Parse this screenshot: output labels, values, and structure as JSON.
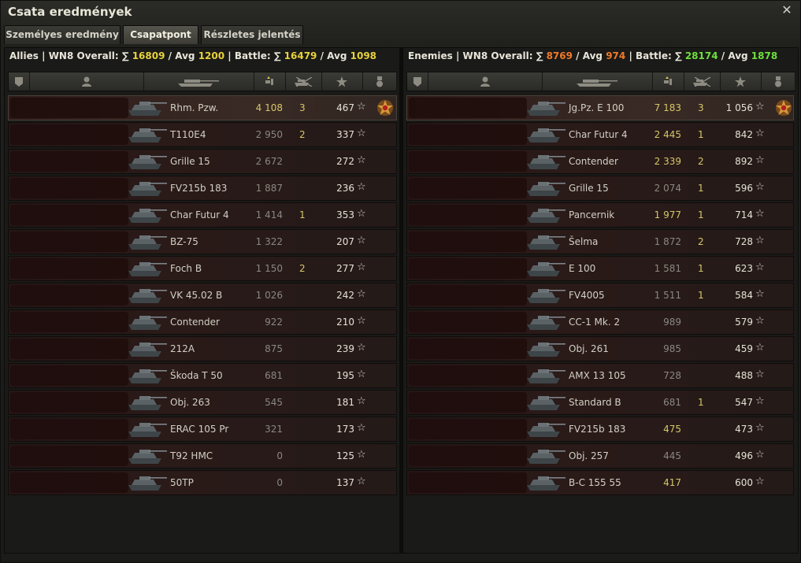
{
  "window": {
    "title": "Csata eredmények"
  },
  "tabs": [
    {
      "label": "Személyes eredmény",
      "active": false
    },
    {
      "label": "Csapatpont",
      "active": true
    },
    {
      "label": "Részletes jelentés",
      "active": false
    }
  ],
  "colors": {
    "yellow": "#e8d23c",
    "orange": "#f07a28",
    "green": "#6ee03c",
    "dmg_gray": "#8a8880",
    "dmg_dim": "#a8a694",
    "dmg_yellow": "#d6c66a"
  },
  "allies": {
    "header": {
      "team": "Allies",
      "sep1": "|",
      "wn8_label": "WN8 Overall:",
      "sum_sym": "∑",
      "overall_sum": "16809",
      "avg_sep": "/",
      "avg_label": "Avg",
      "overall_avg": "1200",
      "sep2": "|",
      "battle_label": "Battle:",
      "battle_sum": "16479",
      "battle_avg": "1098",
      "overall_sum_color": "yellow",
      "overall_avg_color": "yellow",
      "battle_sum_color": "yellow",
      "battle_avg_color": "yellow"
    },
    "rows": [
      {
        "vehicle": "Rhm. Pzw.",
        "damage": "4 108",
        "dmg_tone": "dmg_yellow",
        "kills": "3",
        "xp": "467",
        "top": true
      },
      {
        "vehicle": "T110E4",
        "damage": "2 950",
        "dmg_tone": "dmg_gray",
        "kills": "2",
        "xp": "337"
      },
      {
        "vehicle": "Grille 15",
        "damage": "2 672",
        "dmg_tone": "dmg_gray",
        "kills": "",
        "xp": "272"
      },
      {
        "vehicle": "FV215b 183",
        "damage": "1 887",
        "dmg_tone": "dmg_gray",
        "kills": "",
        "xp": "236"
      },
      {
        "vehicle": "Char Futur 4",
        "damage": "1 414",
        "dmg_tone": "dmg_gray",
        "kills": "1",
        "xp": "353"
      },
      {
        "vehicle": "BZ-75",
        "damage": "1 322",
        "dmg_tone": "dmg_gray",
        "kills": "",
        "xp": "207"
      },
      {
        "vehicle": "Foch B",
        "damage": "1 150",
        "dmg_tone": "dmg_gray",
        "kills": "2",
        "xp": "277"
      },
      {
        "vehicle": "VK 45.02 B",
        "damage": "1 026",
        "dmg_tone": "dmg_gray",
        "kills": "",
        "xp": "242"
      },
      {
        "vehicle": "Contender",
        "damage": "922",
        "dmg_tone": "dmg_gray",
        "kills": "",
        "xp": "210"
      },
      {
        "vehicle": "212A",
        "damage": "875",
        "dmg_tone": "dmg_gray",
        "kills": "",
        "xp": "239"
      },
      {
        "vehicle": "Škoda T 50",
        "damage": "681",
        "dmg_tone": "dmg_gray",
        "kills": "",
        "xp": "195"
      },
      {
        "vehicle": "Obj. 263",
        "damage": "545",
        "dmg_tone": "dmg_gray",
        "kills": "",
        "xp": "181"
      },
      {
        "vehicle": "ERAC 105 Pr",
        "damage": "321",
        "dmg_tone": "dmg_gray",
        "kills": "",
        "xp": "173"
      },
      {
        "vehicle": "T92 HMC",
        "damage": "0",
        "dmg_tone": "dmg_gray",
        "kills": "",
        "xp": "125"
      },
      {
        "vehicle": "50TP",
        "damage": "0",
        "dmg_tone": "dmg_gray",
        "kills": "",
        "xp": "137"
      }
    ]
  },
  "enemies": {
    "header": {
      "team": "Enemies",
      "sep1": "|",
      "wn8_label": "WN8 Overall:",
      "sum_sym": "∑",
      "overall_sum": "8769",
      "avg_sep": "/",
      "avg_label": "Avg",
      "overall_avg": "974",
      "sep2": "|",
      "battle_label": "Battle:",
      "battle_sum": "28174",
      "battle_avg": "1878",
      "overall_sum_color": "orange",
      "overall_avg_color": "orange",
      "battle_sum_color": "green",
      "battle_avg_color": "green"
    },
    "rows": [
      {
        "vehicle": "Jg.Pz. E 100",
        "damage": "7 183",
        "dmg_tone": "dmg_yellow",
        "kills": "3",
        "xp": "1 056",
        "top": true
      },
      {
        "vehicle": "Char Futur 4",
        "damage": "2 445",
        "dmg_tone": "dmg_yellow",
        "kills": "1",
        "xp": "842"
      },
      {
        "vehicle": "Contender",
        "damage": "2 339",
        "dmg_tone": "dmg_yellow",
        "kills": "2",
        "xp": "892"
      },
      {
        "vehicle": "Grille 15",
        "damage": "2 074",
        "dmg_tone": "dmg_gray",
        "kills": "1",
        "xp": "596"
      },
      {
        "vehicle": "Pancernik",
        "damage": "1 977",
        "dmg_tone": "dmg_yellow",
        "kills": "1",
        "xp": "714"
      },
      {
        "vehicle": "Šelma",
        "damage": "1 872",
        "dmg_tone": "dmg_gray",
        "kills": "2",
        "xp": "728"
      },
      {
        "vehicle": "E 100",
        "damage": "1 581",
        "dmg_tone": "dmg_gray",
        "kills": "1",
        "xp": "623"
      },
      {
        "vehicle": "FV4005",
        "damage": "1 511",
        "dmg_tone": "dmg_gray",
        "kills": "1",
        "xp": "584"
      },
      {
        "vehicle": "CC-1 Mk. 2",
        "damage": "989",
        "dmg_tone": "dmg_gray",
        "kills": "",
        "xp": "579"
      },
      {
        "vehicle": "Obj. 261",
        "damage": "985",
        "dmg_tone": "dmg_gray",
        "kills": "",
        "xp": "459"
      },
      {
        "vehicle": "AMX 13 105",
        "damage": "728",
        "dmg_tone": "dmg_gray",
        "kills": "",
        "xp": "488"
      },
      {
        "vehicle": "Standard B",
        "damage": "681",
        "dmg_tone": "dmg_gray",
        "kills": "1",
        "xp": "547"
      },
      {
        "vehicle": "FV215b 183",
        "damage": "475",
        "dmg_tone": "dmg_yellow",
        "kills": "",
        "xp": "473"
      },
      {
        "vehicle": "Obj. 257",
        "damage": "445",
        "dmg_tone": "dmg_gray",
        "kills": "",
        "xp": "496"
      },
      {
        "vehicle": "B-C 155 55",
        "damage": "417",
        "dmg_tone": "dmg_yellow",
        "kills": "",
        "xp": "600"
      }
    ]
  },
  "icons": {
    "star": "☆",
    "close": "✕",
    "columns": [
      "platoon-icon",
      "player-icon",
      "tank-icon",
      "damage-icon",
      "kills-icon",
      "xp-star-icon",
      "medal-icon"
    ]
  }
}
